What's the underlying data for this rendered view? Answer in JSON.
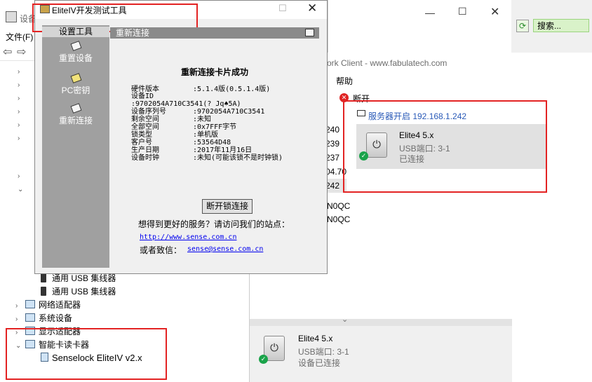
{
  "device_manager": {
    "title": "设备",
    "menu_file": "文件(F)",
    "tree": {
      "usb_hub_1": "通用 USB 集线器",
      "usb_hub_2": "通用 USB 集线器",
      "network": "网络适配器",
      "system": "系统设备",
      "display": "显示适配器",
      "smartcard_reader": "智能卡读卡器",
      "senselock": "Senselock EliteIV v2.x"
    }
  },
  "fabulatech": {
    "title_partial": "ork Client - www.fabulatech.com",
    "menu_help": "帮助",
    "disconnect_label": "断开",
    "search_label": "搜索...",
    "server_label": "服务器开启 192.168.1.242",
    "server_device": {
      "name": "Elite4 5.x",
      "port": "USB端口:   3-1",
      "status": "已连接"
    },
    "ip_list": [
      "240",
      "239",
      "237",
      "04.70",
      "242"
    ],
    "truncated": [
      "N0QC",
      "N0QC"
    ],
    "bottom_device": {
      "name": "Elite4 5.x",
      "port": "USB端口: 3-1",
      "status": "设备已连接"
    }
  },
  "elite_tool": {
    "title": "EliteIV开发测试工具",
    "sidebar": {
      "header": "设置工具",
      "reset": "重置设备",
      "pc_key": "PC密钥",
      "reconnect": "重新连接"
    },
    "panel_header": "重新连接",
    "success": "重新连接卡片成功",
    "info": [
      {
        "k": "硬件版本",
        "v": ":5.1.4版(0.5.1.4版)"
      },
      {
        "k": "设备ID",
        "v": ""
      },
      {
        "k": "",
        "v": ":9702054A710C3541(?  Jq♠5A)"
      },
      {
        "k": "设备序列号",
        "v": ":9702054A710C3541"
      },
      {
        "k": "剩余空间",
        "v": ":未知"
      },
      {
        "k": "全部空间",
        "v": ":0x7FFF字节"
      },
      {
        "k": "锁类型",
        "v": ":单机版"
      },
      {
        "k": "客户号",
        "v": ":53564D48"
      },
      {
        "k": "生产日期",
        "v": ":2017年11月16日"
      },
      {
        "k": "设备时钟",
        "v": ":未知(可能该锁不是时钟锁)"
      }
    ],
    "disconnect_btn": "断开锁连接",
    "service_text": "想得到更好的服务？请访问我们的站点：",
    "url": "http://www.sense.com.cn",
    "email_prefix": "或者致信：",
    "email": "sense@sense.com.cn"
  },
  "colors": {
    "highlight_box": "#e32323",
    "sidebar": "#a0a0a0",
    "link": "#0000ee",
    "ok": "#1aa34a"
  }
}
